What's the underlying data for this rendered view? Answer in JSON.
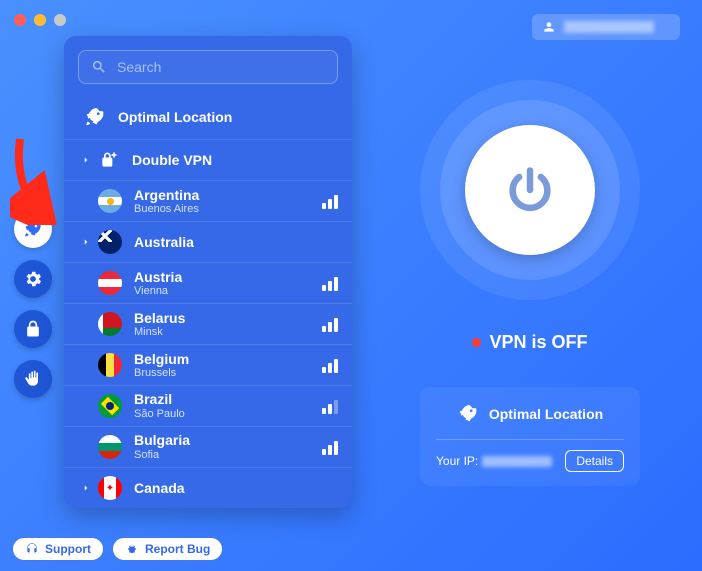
{
  "header": {
    "account_name": "████████"
  },
  "search": {
    "placeholder": "Search",
    "value": ""
  },
  "locations": {
    "optimal_label": "Optimal Location",
    "double_vpn_label": "Double VPN",
    "items": [
      {
        "country": "Argentina",
        "city": "Buenos Aires",
        "flag": "ar",
        "signal": 3
      },
      {
        "country": "Australia",
        "city": "",
        "flag": "au",
        "signal": 0,
        "expandable": true
      },
      {
        "country": "Austria",
        "city": "Vienna",
        "flag": "at",
        "signal": 3
      },
      {
        "country": "Belarus",
        "city": "Minsk",
        "flag": "by",
        "signal": 3
      },
      {
        "country": "Belgium",
        "city": "Brussels",
        "flag": "be",
        "signal": 3
      },
      {
        "country": "Brazil",
        "city": "São Paulo",
        "flag": "br",
        "signal": 2
      },
      {
        "country": "Bulgaria",
        "city": "Sofia",
        "flag": "bg",
        "signal": 3
      },
      {
        "country": "Canada",
        "city": "",
        "flag": "ca",
        "signal": 0,
        "expandable": true
      }
    ]
  },
  "status": {
    "text": "VPN is OFF",
    "color": "#ff3b30"
  },
  "info_card": {
    "title": "Optimal Location",
    "ip_label": "Your IP:",
    "ip_value": "███████",
    "details_label": "Details"
  },
  "bottom": {
    "support_label": "Support",
    "report_label": "Report Bug"
  },
  "rail": {
    "items": [
      "rocket",
      "gear",
      "lock",
      "hand"
    ],
    "active_index": 0
  }
}
